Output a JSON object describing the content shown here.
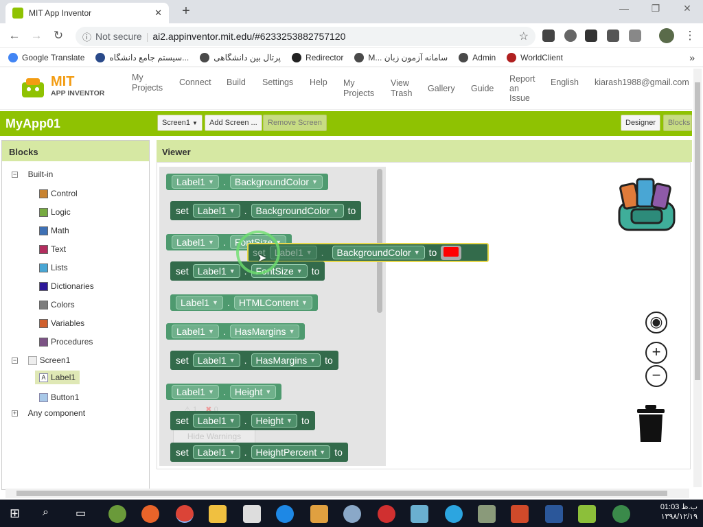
{
  "browser": {
    "tab_title": "MIT App Inventor",
    "not_secure": "Not secure",
    "url": "ai2.appinventor.mit.edu/#6233253882757120",
    "bookmarks": [
      "Google Translate",
      "سیستم جامع دانشگاه...",
      "پرتال بین دانشگاهی",
      "Redirector",
      "M... سامانه آزمون زبان",
      "Admin",
      "WorldClient"
    ]
  },
  "header": {
    "logo_line1": "MIT",
    "logo_line2": "APP INVENTOR",
    "nav": {
      "my_projects_dd": "My\nProjects",
      "connect": "Connect",
      "build": "Build",
      "settings": "Settings",
      "help": "Help",
      "my_projects": "My\nProjects",
      "view_trash": "View\nTrash",
      "gallery": "Gallery",
      "guide": "Guide",
      "report_issue": "Report\nan\nIssue",
      "language": "English",
      "user": "kiarash1988@gmail.com"
    }
  },
  "toolbar": {
    "app_name": "MyApp01",
    "screen_select": "Screen1",
    "add_screen": "Add Screen ...",
    "remove_screen": "Remove Screen",
    "designer": "Designer",
    "blocks": "Blocks"
  },
  "blocks_panel": {
    "title": "Blocks",
    "built_in": "Built-in",
    "categories": [
      {
        "label": "Control",
        "color": "#c88330"
      },
      {
        "label": "Logic",
        "color": "#77ab41"
      },
      {
        "label": "Math",
        "color": "#3f71b5"
      },
      {
        "label": "Text",
        "color": "#b32d5e"
      },
      {
        "label": "Lists",
        "color": "#49a6d4"
      },
      {
        "label": "Dictionaries",
        "color": "#2d1799"
      },
      {
        "label": "Colors",
        "color": "#7d7d7d"
      },
      {
        "label": "Variables",
        "color": "#d05f2d"
      },
      {
        "label": "Procedures",
        "color": "#7c5385"
      }
    ],
    "screen": "Screen1",
    "components": [
      "Label1",
      "Button1"
    ],
    "any_component": "Any component"
  },
  "viewer": {
    "title": "Viewer",
    "component": "Label1",
    "set": "set",
    "to": "to",
    "dot": ".",
    "properties": {
      "background_color": "BackgroundColor",
      "font_size": "FontSize",
      "html_content": "HTMLContent",
      "has_margins": "HasMargins",
      "height": "Height",
      "height_percent": "HeightPercent"
    },
    "dragged_color": "#ff0000",
    "warnings": {
      "count_warn": "1",
      "count_err": "0",
      "hide": "Hide Warnings"
    }
  },
  "taskbar": {
    "time": "01:03 ب.ظ",
    "date": "۱۳۹۸/۱۲/۱۹"
  }
}
